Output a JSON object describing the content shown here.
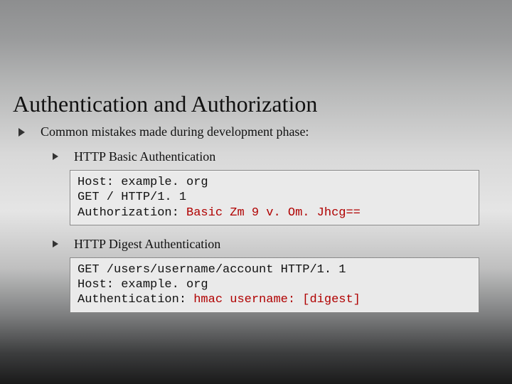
{
  "title": "Authentication and Authorization",
  "intro": "Common mistakes made during development phase:",
  "sec1": {
    "heading": "HTTP Basic Authentication",
    "code": {
      "l1": "Host: example. org",
      "l2": "GET / HTTP/1. 1",
      "l3a": "Authorization: ",
      "l3b": "Basic ",
      "l3c": "Zm 9 v. Om. Jhcg=="
    }
  },
  "sec2": {
    "heading": "HTTP Digest Authentication",
    "code": {
      "l1": "GET /users/username/account HTTP/1. 1",
      "l2": "Host: example. org",
      "l3a": "Authentication: ",
      "l3b": "hmac ",
      "l3c": "username: [digest]"
    }
  }
}
